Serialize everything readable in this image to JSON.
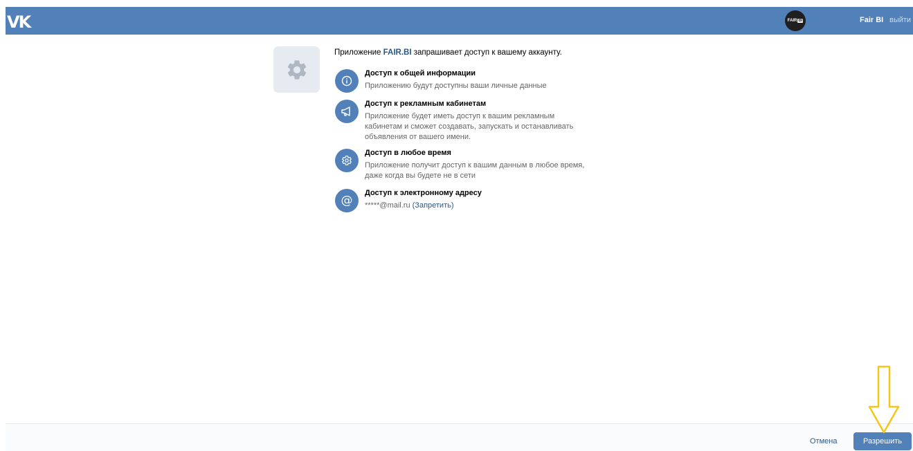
{
  "header": {
    "logo": "VK",
    "avatar_text": "FAIR",
    "avatar_badge": "BI",
    "user_name": "Fair BI",
    "logout_label": "выйти"
  },
  "request": {
    "prefix": "Приложение ",
    "app_name": "FAIR.BI",
    "suffix": " запрашивает доступ к вашему аккаунту."
  },
  "permissions": [
    {
      "icon": "info-icon",
      "title": "Доступ к общей информации",
      "desc": "Приложению будут доступны ваши личные данные"
    },
    {
      "icon": "megaphone-icon",
      "title": "Доступ к рекламным кабинетам",
      "desc": "Приложение будет иметь доступ к вашим рекламным кабинетам и сможет создавать, запускать и останавливать объявления от вашего имени."
    },
    {
      "icon": "gear-icon",
      "title": "Доступ в любое время",
      "desc": "Приложение получит доступ к вашим данным в любое время, даже когда вы будете не в сети"
    },
    {
      "icon": "at-icon",
      "title": "Доступ к электронному адресу",
      "email": "*****@mail.ru",
      "deny_label": "(Запретить)"
    }
  ],
  "footer": {
    "cancel_label": "Отмена",
    "allow_label": "Разрешить"
  },
  "colors": {
    "brand": "#5181b8",
    "link": "#2a5885",
    "arrow": "#f5c518"
  }
}
